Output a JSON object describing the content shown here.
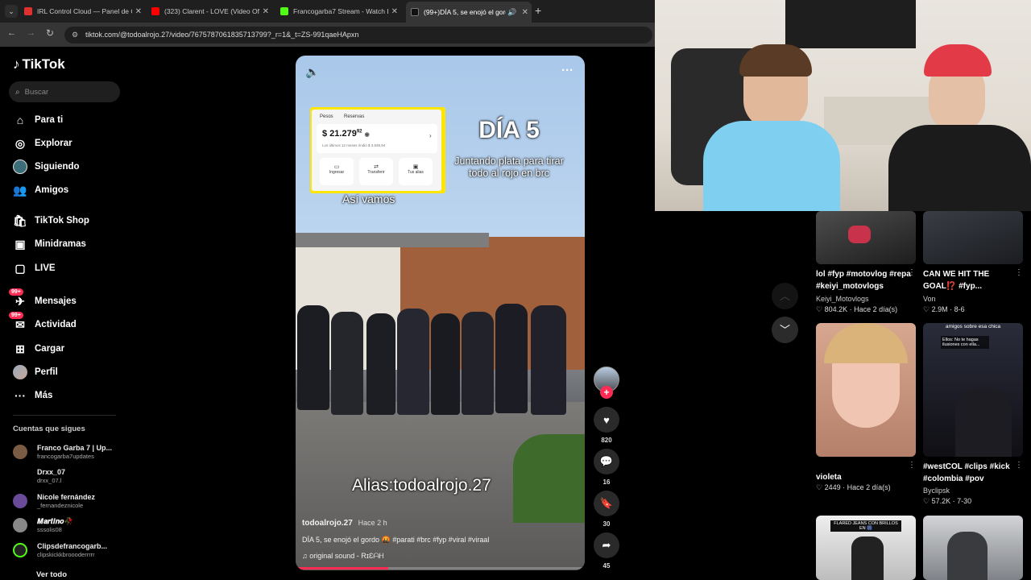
{
  "browser": {
    "tabs": [
      {
        "label": "IRL Control Cloud — Panel de C",
        "fav_color": "#e03131"
      },
      {
        "label": "(323) Clarent - LOVE (Video Ofi",
        "fav_color": "#ff0000"
      },
      {
        "label": "Francogarba7 Stream - Watch L",
        "fav_color": "#53fc18"
      },
      {
        "label": "(99+)DÍA 5, se enojó el gord",
        "fav_color": "#111111"
      }
    ],
    "url": "tiktok.com/@todoalrojo.27/video/7675787061835713799?_r=1&_t=ZS-991qaeHApxn"
  },
  "tiktok": {
    "logo": "TikTok",
    "search_placeholder": "Buscar",
    "nav": [
      {
        "label": "Para ti",
        "icon": "home-icon"
      },
      {
        "label": "Explorar",
        "icon": "compass-icon"
      },
      {
        "label": "Siguiendo",
        "icon": "following-icon"
      },
      {
        "label": "Amigos",
        "icon": "friends-icon"
      },
      {
        "label": "TikTok Shop",
        "icon": "shop-icon"
      },
      {
        "label": "Minidramas",
        "icon": "film-icon"
      },
      {
        "label": "LIVE",
        "icon": "live-icon"
      },
      {
        "label": "Mensajes",
        "icon": "messages-icon",
        "badge": "99+"
      },
      {
        "label": "Actividad",
        "icon": "activity-icon",
        "badge": "99+"
      },
      {
        "label": "Cargar",
        "icon": "upload-icon"
      },
      {
        "label": "Perfil",
        "icon": "profile-icon"
      },
      {
        "label": "Más",
        "icon": "more-icon"
      }
    ],
    "following_title": "Cuentas que sigues",
    "following": [
      {
        "name": "Franco Garba 7 | Up...",
        "handle": "francogarba7updates",
        "color": "#7a5c45"
      },
      {
        "name": "Drxx_07",
        "handle": "drxx_07.l",
        "color": "#000000"
      },
      {
        "name": "Nicole fernández",
        "handle": "_fernandeznicole",
        "color": "#6a4b9a"
      },
      {
        "name": "𝑴𝒂𝒓𝒕𝒊𝒏𝒐🥀",
        "handle": "sssolis08",
        "color": "#888888"
      },
      {
        "name": "Clipsdefrancogarb...",
        "handle": "clipskickkbroooderrrrr",
        "color": "#53fc18"
      }
    ],
    "see_all": "Ver todo"
  },
  "video": {
    "overlay": {
      "day": "DÍA 5",
      "subtitle": "Juntando plata para tirar todo al rojo en brc",
      "progress_caption": "Así vamos",
      "alias": "Alias:todoalrojo.27"
    },
    "bank_card": {
      "tab_1": "Pesos",
      "tab_2": "Reservas",
      "amount": "$ 21.279",
      "cents": "92",
      "note": "Los últimos 12 meses rindió $ 3.838,94",
      "actions": [
        "Ingresar",
        "Transferir",
        "Tus alias"
      ]
    },
    "author": "todoalrojo.27",
    "posted": "Hace 2 h",
    "caption": "DÍA 5, se enojó el gordo 🤬 #parati #brc #fyp #viral #viraal",
    "sound": "♫ original sound - RɪƐᗩᕼ",
    "actions": {
      "likes": "820",
      "comments": "16",
      "saves": "30",
      "shares": "45"
    }
  },
  "related": [
    {
      "title": "lol #fyp #motovlog #repa #keiyi_motovlogs",
      "author": "Keiyi_Motovlogs",
      "likes": "804.2K",
      "date": "Hace 2 día(s)"
    },
    {
      "title": "CAN WE HIT THE GOAL⁉️ #fyp...",
      "author": "Von",
      "likes": "2.9M",
      "date": "8-6"
    },
    {
      "title": "violeta",
      "author": "",
      "likes": "2449",
      "date": "Hace 2 día(s)"
    },
    {
      "title": "#westCOL #clips #kick #colombia #pov",
      "author": "Byclipsk",
      "likes": "57.2K",
      "date": "7-30"
    }
  ],
  "related_overlays": {
    "thumb_4_top": "amigos sobre esa chica",
    "thumb_4_caption": "Ellos: No te hagas ilusiones con ella...",
    "thumb_5_caption": "FLARED JEANS CON BRILLOS EN 🎆"
  }
}
